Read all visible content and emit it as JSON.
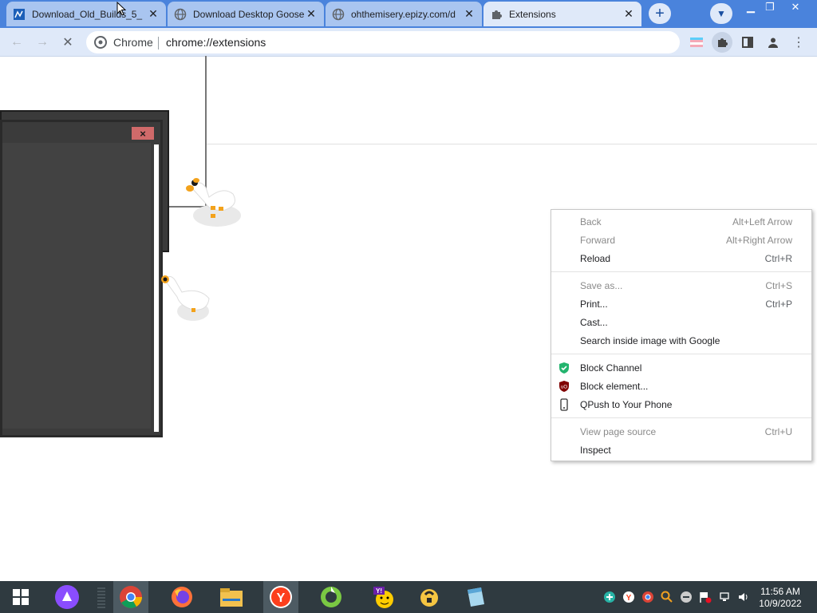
{
  "browser": {
    "tabs": [
      {
        "title": "Download_Old_Builds_5_",
        "icon": "app-icon",
        "active": false
      },
      {
        "title": "Download Desktop Goose",
        "icon": "globe-icon",
        "active": false
      },
      {
        "title": "ohthemisery.epizy.com/d",
        "icon": "globe-icon",
        "active": false
      },
      {
        "title": "Extensions",
        "icon": "puzzle-icon",
        "active": true
      }
    ],
    "new_tab_label": "+",
    "omnibox": {
      "site_label": "Chrome",
      "url": "chrome://extensions"
    }
  },
  "darkwin": {
    "close_label": "×"
  },
  "context_menu": {
    "groups": [
      [
        {
          "label": "Back",
          "shortcut": "Alt+Left Arrow",
          "enabled": false
        },
        {
          "label": "Forward",
          "shortcut": "Alt+Right Arrow",
          "enabled": false
        },
        {
          "label": "Reload",
          "shortcut": "Ctrl+R",
          "enabled": true
        }
      ],
      [
        {
          "label": "Save as...",
          "shortcut": "Ctrl+S",
          "enabled": false
        },
        {
          "label": "Print...",
          "shortcut": "Ctrl+P",
          "enabled": true
        },
        {
          "label": "Cast...",
          "shortcut": "",
          "enabled": true
        },
        {
          "label": "Search inside image with Google",
          "shortcut": "",
          "enabled": true
        }
      ],
      [
        {
          "label": "Block Channel",
          "shortcut": "",
          "enabled": true,
          "icon": "shield-icon"
        },
        {
          "label": "Block element...",
          "shortcut": "",
          "enabled": true,
          "icon": "ublock-icon"
        },
        {
          "label": "QPush to Your Phone",
          "shortcut": "",
          "enabled": true,
          "icon": "phone-icon"
        }
      ],
      [
        {
          "label": "View page source",
          "shortcut": "Ctrl+U",
          "enabled": false
        },
        {
          "label": "Inspect",
          "shortcut": "",
          "enabled": true
        }
      ]
    ]
  },
  "taskbar": {
    "apps": [
      "windows-start-icon",
      "alice-assistant-icon",
      "chrome-icon",
      "firefox-icon",
      "file-explorer-icon",
      "yandex-browser-icon",
      "app-green-icon",
      "yahoo-messenger-icon",
      "sandbox-icon",
      "notepad-icon"
    ],
    "clock_time": "11:56 AM",
    "clock_date": "10/9/2022"
  },
  "colors": {
    "tabstrip": "#4a83dc",
    "toolbar": "#dfe9f9",
    "taskbar": "#2f3a40"
  }
}
